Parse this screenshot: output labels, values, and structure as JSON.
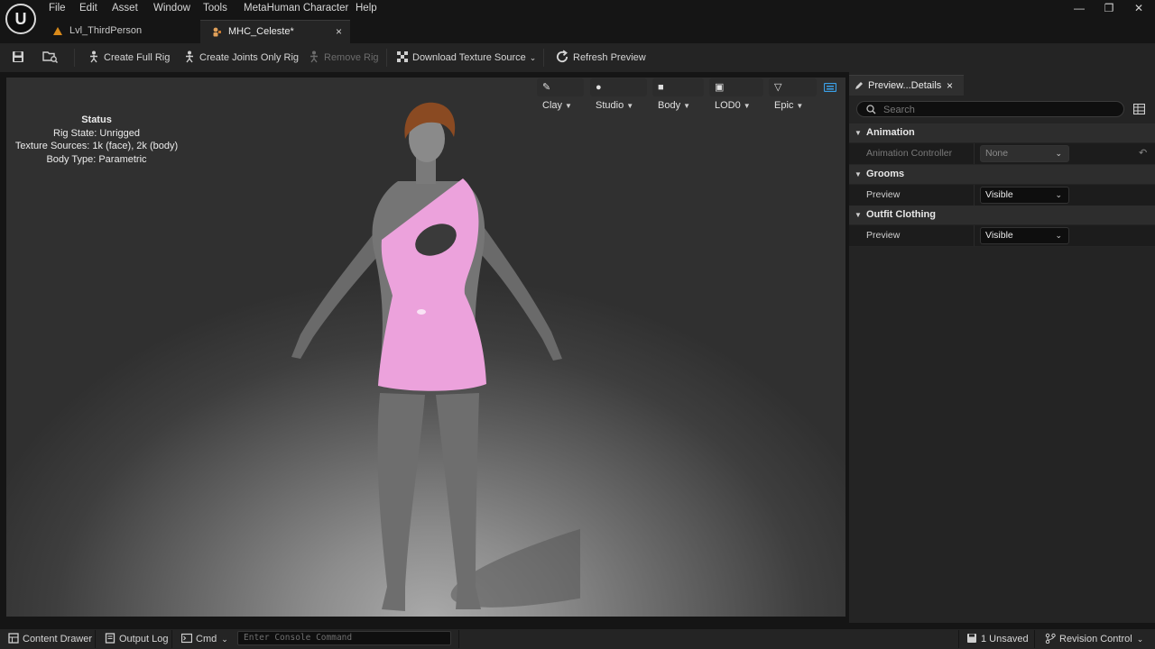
{
  "menu": {
    "items": [
      "File",
      "Edit",
      "Asset",
      "Window",
      "Tools",
      "MetaHuman Character",
      "Help"
    ]
  },
  "window_controls": {
    "minimize": "—",
    "restore": "❐",
    "close": "✕"
  },
  "tabs": [
    {
      "label": "Lvl_ThirdPerson",
      "icon": "level-icon",
      "active": false
    },
    {
      "label": "MHC_Celeste*",
      "icon": "metahuman-character-icon",
      "active": true,
      "close": "×"
    }
  ],
  "toolbar": {
    "create_full_rig": "Create Full Rig",
    "create_joints_only_rig": "Create Joints Only Rig",
    "remove_rig": "Remove Rig",
    "download_texture_source": "Download Texture Source",
    "refresh_preview": "Refresh Preview"
  },
  "viewport": {
    "options": {
      "clay": "Clay",
      "studio": "Studio",
      "body": "Body",
      "lod": "LOD0",
      "quality": "Epic"
    },
    "status": {
      "title": "Status",
      "rig_state": "Rig State: Unrigged",
      "texture_sources": "Texture Sources: 1k (face), 2k (body)",
      "body_type": "Body Type: Parametric"
    },
    "outfit_color": "#eca2dc",
    "hair_color": "#8a4a22"
  },
  "details_panel": {
    "tab_label": "Preview...Details",
    "tab_close": "×",
    "search_placeholder": "Search",
    "categories": {
      "animation": {
        "label": "Animation",
        "controller_label": "Animation Controller",
        "controller_value": "None"
      },
      "grooms": {
        "label": "Grooms",
        "preview_label": "Preview",
        "preview_value": "Visible"
      },
      "outfit_clothing": {
        "label": "Outfit Clothing",
        "preview_label": "Preview",
        "preview_value": "Visible"
      }
    }
  },
  "bottom_bar": {
    "content_drawer": "Content Drawer",
    "output_log": "Output Log",
    "cmd": "Cmd",
    "console_placeholder": "Enter Console Command",
    "unsaved": "1 Unsaved",
    "revision_control": "Revision Control"
  }
}
